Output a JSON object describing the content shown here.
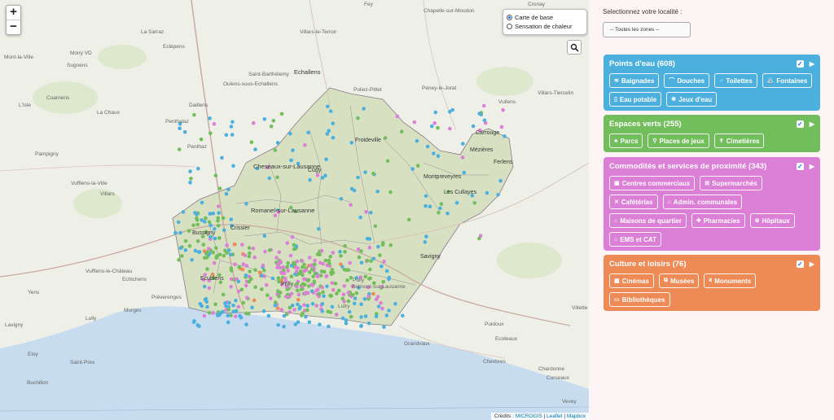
{
  "map": {
    "zoom_in": "+",
    "zoom_out": "−",
    "layers": {
      "base": "Carte de base",
      "heat": "Sensation de chaleur"
    },
    "search_icon": "magnifier-icon",
    "credits_prefix": "Crédits :",
    "credits_links": [
      "MICROGIS",
      "Leaflet",
      "Mapbox"
    ],
    "lake_color": "#c7dcef",
    "zone_color": "#cfdcb6",
    "labels": [
      "Fey",
      "Chapelle-sur-Moudon",
      "Cronay",
      "La Sarraz",
      "Villars-le-Terroir",
      "Mont-la-Ville",
      "Moiry VD",
      "Eclépens",
      "Sugnens",
      "Echallens",
      "Saint-Barthélemy",
      "Oulens-sous-Echallens",
      "Poliez-Pittet",
      "Peney-le-Jorat",
      "L'Isle",
      "Daillens",
      "Cuarnens",
      "La Chaux",
      "Penthalaz",
      "Villars-Tiercelin",
      "Vullens",
      "Penthaz",
      "Froideville",
      "Carrouge",
      "Mézières",
      "Ferlens",
      "Pampigny",
      "Cheseaux-sur-Lausanne",
      "Cugy",
      "Montpreveyres",
      "Vufflens-la-Ville",
      "Les Cullayes",
      "Villars",
      "Romanel-sur-Lausanne",
      "Bussigny",
      "Crissier",
      "Savigny",
      "Vufflens-le-Château",
      "Echichens",
      "Ecublens",
      "Prilly",
      "Préverenges",
      "Pully",
      "Morges",
      "Belmont-sur-Lausanne",
      "Yens",
      "Lutry",
      "Lully",
      "Lavigny",
      "Puidoux",
      "Eloy",
      "Grandvaux",
      "Saint-Prex",
      "Chexbres",
      "Buchillon",
      "Chardonne",
      "Corseaux",
      "Vevey",
      "Ecoteaux",
      "Villette"
    ]
  },
  "panel": {
    "prompt": "Selectionnez votre localité :",
    "select_value": "-- Toutes les zones --",
    "categories": [
      {
        "title": "Points d'eau (608)",
        "color": "#4cb0de",
        "buttons": [
          {
            "label": "Baignades",
            "icon": "swimmer-icon"
          },
          {
            "label": "Douches",
            "icon": "shower-icon"
          },
          {
            "label": "Toilettes",
            "icon": "toilet-icon"
          },
          {
            "label": "Fontaines",
            "icon": "fountain-icon"
          },
          {
            "label": "Eau potable",
            "icon": "water-bottle-icon"
          },
          {
            "label": "Jeux d'eau",
            "icon": "water-play-icon"
          }
        ]
      },
      {
        "title": "Espaces verts (255)",
        "color": "#72bd5c",
        "buttons": [
          {
            "label": "Parcs",
            "icon": "tree-icon"
          },
          {
            "label": "Places de jeux",
            "icon": "playground-icon"
          },
          {
            "label": "Cimetières",
            "icon": "cemetery-icon"
          }
        ]
      },
      {
        "title": "Commodités et services de proximité (343)",
        "color": "#dc7fd6",
        "buttons": [
          {
            "label": "Centres commerciaux",
            "icon": "shop-icon"
          },
          {
            "label": "Supermarchés",
            "icon": "cart-icon"
          },
          {
            "label": "Cafétérias",
            "icon": "cutlery-icon"
          },
          {
            "label": "Admin. communales",
            "icon": "admin-icon"
          },
          {
            "label": "Maisons de quartier",
            "icon": "house-icon"
          },
          {
            "label": "Pharmacies",
            "icon": "pharmacy-icon"
          },
          {
            "label": "Hôpitaux",
            "icon": "hospital-icon"
          },
          {
            "label": "EMS et CAT",
            "icon": "home-care-icon"
          }
        ]
      },
      {
        "title": "Culture et loisirs (76)",
        "color": "#ee8a55",
        "buttons": [
          {
            "label": "Cinémas",
            "icon": "film-icon"
          },
          {
            "label": "Musées",
            "icon": "museum-icon"
          },
          {
            "label": "Monuments",
            "icon": "monument-icon"
          },
          {
            "label": "Bibliothèques",
            "icon": "book-icon"
          }
        ]
      }
    ]
  }
}
